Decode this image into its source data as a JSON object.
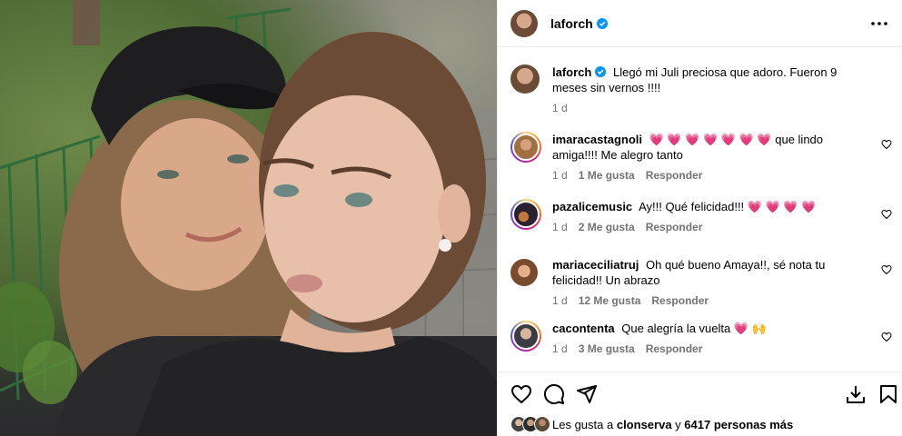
{
  "post": {
    "author": "laforch",
    "caption": "Llegó mi Juli preciosa que adoro. Fueron 9 meses sin vernos !!!!",
    "caption_time": "1 d"
  },
  "comments": [
    {
      "user": "imaracastagnoli",
      "hearts": "💗 💗 💗 💗 💗 💗 💗",
      "text": "que lindo amiga!!!! Me alegro tanto",
      "time": "1 d",
      "likes": "1 Me gusta",
      "reply": "Responder"
    },
    {
      "user": "pazalicemusic",
      "text": "Ay!!! Qué felicidad!!!",
      "hearts": "💗 💗 💗 💗",
      "time": "1 d",
      "likes": "2 Me gusta",
      "reply": "Responder"
    },
    {
      "user": "mariaceciliatruj",
      "text": "Oh qué bueno Amaya!!, sé nota tu felicidad!! Un abrazo",
      "time": "1 d",
      "likes": "12 Me gusta",
      "reply": "Responder"
    },
    {
      "user": "cacontenta",
      "text": "Que alegría la vuelta",
      "hearts": "💗 🙌",
      "time": "1 d",
      "likes": "3 Me gusta",
      "reply": "Responder"
    }
  ],
  "likes_line": {
    "prefix": "Les gusta a",
    "user": "clonserva",
    "middle": "y",
    "count": "6417 personas más"
  },
  "colors": {
    "verified": "#0095f6",
    "heart": "#ed2c4f",
    "muted": "#737373",
    "border": "#efefef"
  },
  "icons": [
    "verified-badge-icon",
    "more-options-icon",
    "comment-heart-icon",
    "like-icon",
    "comment-icon",
    "share-icon",
    "download-icon",
    "save-icon"
  ]
}
